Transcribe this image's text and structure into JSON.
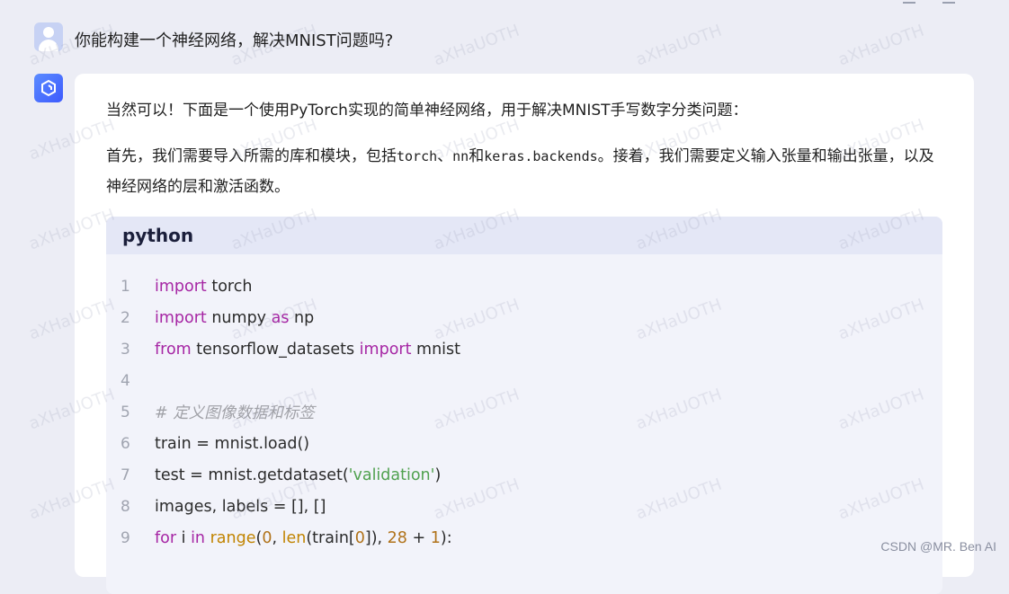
{
  "user_message": "你能构建一个神经网络，解决MNIST问题吗?",
  "bot": {
    "intro": "当然可以！下面是一个使用PyTorch实现的简单神经网络，用于解决MNIST手写数字分类问题：",
    "para2_prefix": "首先，我们需要导入所需的库和模块，包括",
    "para2_code1": "torch",
    "para2_sep1": "、",
    "para2_code2": "nn",
    "para2_sep2": "和",
    "para2_code3": "keras.backends",
    "para2_suffix": "。接着，我们需要定义输入张量和输出张量，以及神经网络的层和激活函数。"
  },
  "code_block": {
    "language": "python",
    "line_numbers": [
      "1",
      "2",
      "3",
      "4",
      "5",
      "6",
      "7",
      "8",
      "9"
    ]
  },
  "watermark_text": "aXHaUOTH",
  "footer": "CSDN @MR. Ben AI"
}
